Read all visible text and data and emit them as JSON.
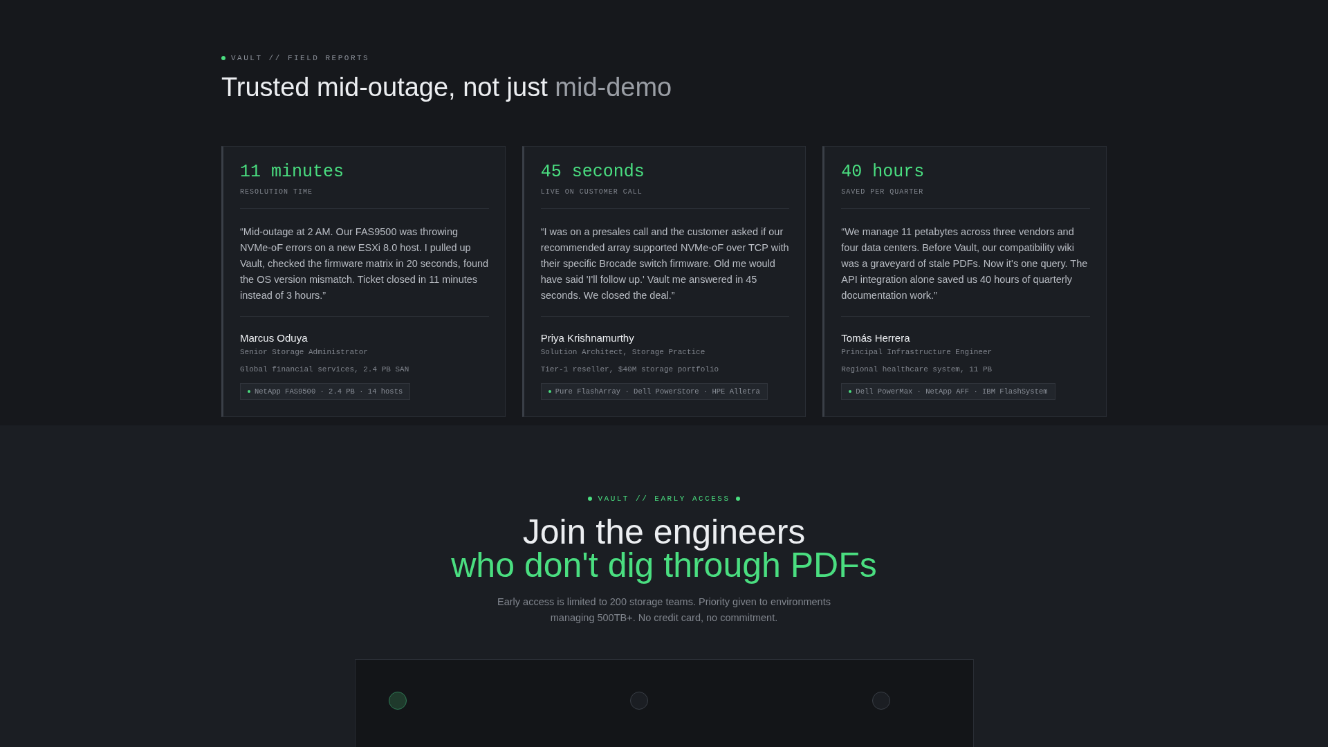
{
  "reports": {
    "eyebrow": "VAULT // FIELD REPORTS",
    "title": "Trusted mid-outage, not just",
    "title_muted": "mid-demo",
    "cards": [
      {
        "metric": "11 minutes",
        "metric_label": "RESOLUTION TIME",
        "quote": "“Mid-outage at 2 AM. Our FAS9500 was throwing NVMe-oF errors on a new ESXi 8.0 host. I pulled up Vault, checked the firmware matrix in 20 seconds, found the OS version mismatch. Ticket closed in 11 minutes instead of 3 hours.”",
        "name": "Marcus Oduya",
        "role": "Senior Storage Administrator",
        "org": "Global financial services, 2.4 PB SAN",
        "tag": "NetApp FAS9500 · 2.4 PB · 14 hosts"
      },
      {
        "metric": "45 seconds",
        "metric_label": "LIVE ON CUSTOMER CALL",
        "quote": "“I was on a presales call and the customer asked if our recommended array supported NVMe-oF over TCP with their specific Brocade switch firmware. Old me would have said 'I'll follow up.' Vault me answered in 45 seconds. We closed the deal.”",
        "name": "Priya Krishnamurthy",
        "role": "Solution Architect, Storage Practice",
        "org": "Tier-1 reseller, $40M storage portfolio",
        "tag": "Pure FlashArray · Dell PowerStore · HPE Alletra"
      },
      {
        "metric": "40 hours",
        "metric_label": "SAVED PER QUARTER",
        "quote": "“We manage 11 petabytes across three vendors and four data centers. Before Vault, our compatibility wiki was a graveyard of stale PDFs. Now it's one query. The API integration alone saved us 40 hours of quarterly documentation work.”",
        "name": "Tomás Herrera",
        "role": "Principal Infrastructure Engineer",
        "org": "Regional healthcare system, 11 PB",
        "tag": "Dell PowerMax · NetApp AFF · IBM FlashSystem"
      }
    ]
  },
  "early_access": {
    "eyebrow": "VAULT // EARLY ACCESS",
    "title": "Join the engineers",
    "title_accent": "who don't dig through PDFs",
    "description": "Early access is limited to 200 storage teams. Priority given to environments managing 500TB+. No credit card, no commitment.",
    "steps": [
      {
        "selected": true
      },
      {
        "selected": false
      },
      {
        "selected": false
      }
    ]
  }
}
